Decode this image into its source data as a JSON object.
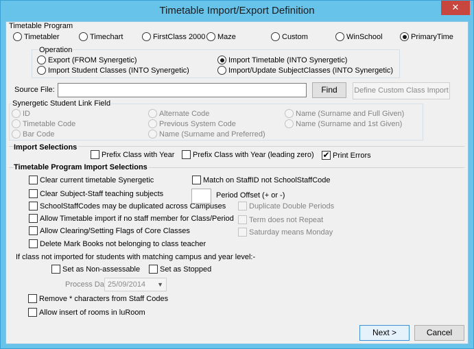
{
  "window": {
    "title": "Timetable Import/Export Definition",
    "close_glyph": "✕"
  },
  "timetable_program": {
    "label": "Timetable Program",
    "options": [
      {
        "label": "Timetabler",
        "selected": false
      },
      {
        "label": "Timechart",
        "selected": false
      },
      {
        "label": "FirstClass 2000",
        "selected": false
      },
      {
        "label": "Maze",
        "selected": false
      },
      {
        "label": "Custom",
        "selected": false
      },
      {
        "label": "WinSchool",
        "selected": false
      },
      {
        "label": "PrimaryTime",
        "selected": true
      }
    ]
  },
  "operation": {
    "label": "Operation",
    "options": [
      {
        "label": "Export (FROM Synergetic)",
        "selected": false
      },
      {
        "label": "Import Timetable (INTO Synergetic)",
        "selected": true
      },
      {
        "label": "Import Student Classes (INTO Synergetic)",
        "selected": false
      },
      {
        "label": "Import/Update SubjectClasses (INTO Synergetic)",
        "selected": false
      }
    ]
  },
  "source_file": {
    "label": "Source File:",
    "value": "",
    "find_label": "Find",
    "define_label": "Define Custom Class Import"
  },
  "link_field": {
    "label": "Synergetic Student Link Field",
    "options": [
      {
        "label": "ID",
        "selected": true
      },
      {
        "label": "Timetable Code",
        "selected": false
      },
      {
        "label": "Bar Code",
        "selected": false
      },
      {
        "label": "Alternate Code",
        "selected": false
      },
      {
        "label": "Previous System Code",
        "selected": false
      },
      {
        "label": "Name (Surname and Preferred)",
        "selected": false
      },
      {
        "label": "Name (Surname and Full Given)",
        "selected": false
      },
      {
        "label": "Name (Surname and 1st Given)",
        "selected": false
      }
    ]
  },
  "import_selections": {
    "label": "Import Selections",
    "options": [
      {
        "label": "Prefix Class with Year",
        "checked": false
      },
      {
        "label": "Prefix Class with Year (leading zero)",
        "checked": false
      },
      {
        "label": "Print Errors",
        "checked": true
      }
    ]
  },
  "program_import": {
    "label": "Timetable Program Import Selections",
    "left": [
      {
        "label": "Clear current timetable Synergetic",
        "checked": false
      },
      {
        "label": "Clear Subject-Staff teaching subjects",
        "checked": false
      },
      {
        "label": "SchoolStaffCodes may be duplicated across Campuses",
        "checked": false
      },
      {
        "label": "Allow Timetable import if no staff member for Class/Period",
        "checked": false
      },
      {
        "label": "Allow Clearing/Setting Flags of Core Classes",
        "checked": false
      },
      {
        "label": "Delete Mark Books not belonging to class teacher",
        "checked": false
      }
    ],
    "match_staff": {
      "label": "Match on StaffID not SchoolStaffCode",
      "checked": false
    },
    "period_offset": {
      "label": "Period Offset (+ or -)",
      "value": ""
    },
    "right_disabled": [
      {
        "label": "Duplicate Double Periods",
        "checked": false
      },
      {
        "label": "Term does not Repeat",
        "checked": false
      },
      {
        "label": "Saturday means Monday",
        "checked": false
      }
    ],
    "not_imported_text": "If class not imported for students with matching campus and year level:-",
    "non_assessable": {
      "label": "Set as Non-assessable",
      "checked": false
    },
    "stopped": {
      "label": "Set as Stopped",
      "checked": false
    },
    "process_date": {
      "label": "Process Date:",
      "value": "25/09/2014"
    },
    "remove_star": {
      "label": "Remove * characters from Staff Codes",
      "checked": false
    },
    "allow_rooms": {
      "label": "Allow insert of rooms in luRoom",
      "checked": false
    }
  },
  "footer": {
    "next_label": "Next >",
    "cancel_label": "Cancel"
  }
}
